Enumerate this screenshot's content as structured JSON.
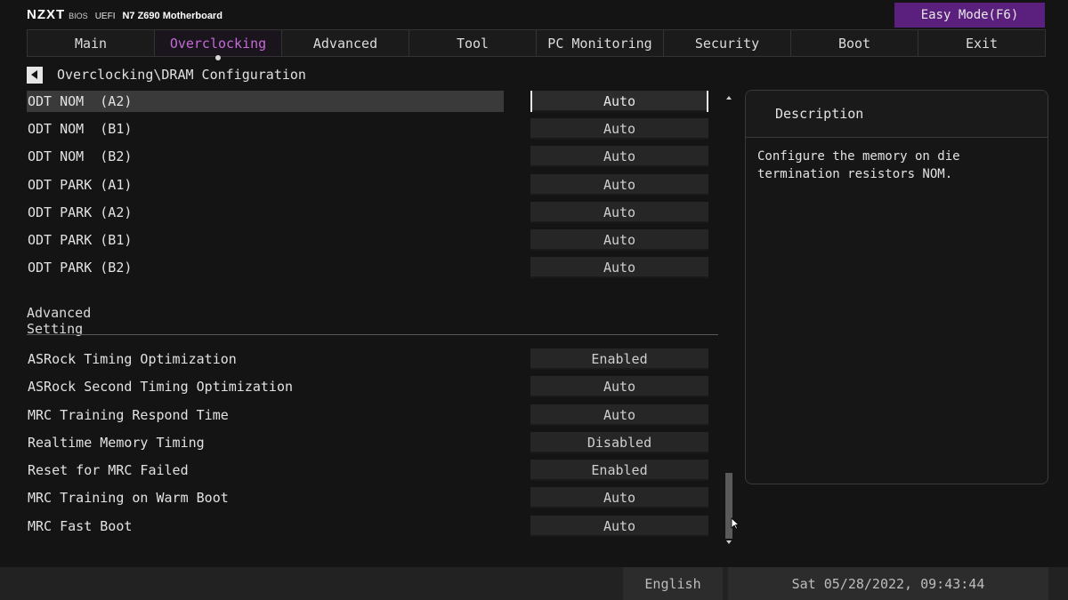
{
  "header": {
    "logo": "NZXT",
    "bios": "BIOS",
    "uefi": "UEFI",
    "model": "N7 Z690 Motherboard",
    "easy_mode": "Easy Mode(F6)"
  },
  "nav": {
    "tabs": [
      {
        "label": "Main"
      },
      {
        "label": "Overclocking"
      },
      {
        "label": "Advanced"
      },
      {
        "label": "Tool"
      },
      {
        "label": "PC Monitoring"
      },
      {
        "label": "Security"
      },
      {
        "label": "Boot"
      },
      {
        "label": "Exit"
      }
    ],
    "active": "Overclocking"
  },
  "breadcrumb": "Overclocking\\DRAM Configuration",
  "settings_top": [
    {
      "label": "ODT NOM  (A2)",
      "value": "Auto"
    },
    {
      "label": "ODT NOM  (B1)",
      "value": "Auto"
    },
    {
      "label": "ODT NOM  (B2)",
      "value": "Auto"
    },
    {
      "label": "ODT PARK (A1)",
      "value": "Auto"
    },
    {
      "label": "ODT PARK (A2)",
      "value": "Auto"
    },
    {
      "label": "ODT PARK (B1)",
      "value": "Auto"
    },
    {
      "label": "ODT PARK (B2)",
      "value": "Auto"
    }
  ],
  "section_title": "Advanced Setting",
  "settings_bottom": [
    {
      "label": "ASRock Timing Optimization",
      "value": "Enabled"
    },
    {
      "label": "ASRock Second Timing Optimization",
      "value": "Auto"
    },
    {
      "label": "MRC Training Respond Time",
      "value": "Auto"
    },
    {
      "label": "Realtime Memory Timing",
      "value": "Disabled"
    },
    {
      "label": "Reset for MRC Failed",
      "value": "Enabled"
    },
    {
      "label": "MRC Training on Warm Boot",
      "value": "Auto"
    },
    {
      "label": "MRC Fast Boot",
      "value": "Auto"
    }
  ],
  "description": {
    "title": "Description",
    "text": "Configure the memory on die termination resistors NOM."
  },
  "footer": {
    "language": "English",
    "datetime": "Sat 05/28/2022, 09:43:44"
  },
  "colors": {
    "accent": "#c46bd6",
    "easy_mode_bg": "#5b1f7e"
  }
}
